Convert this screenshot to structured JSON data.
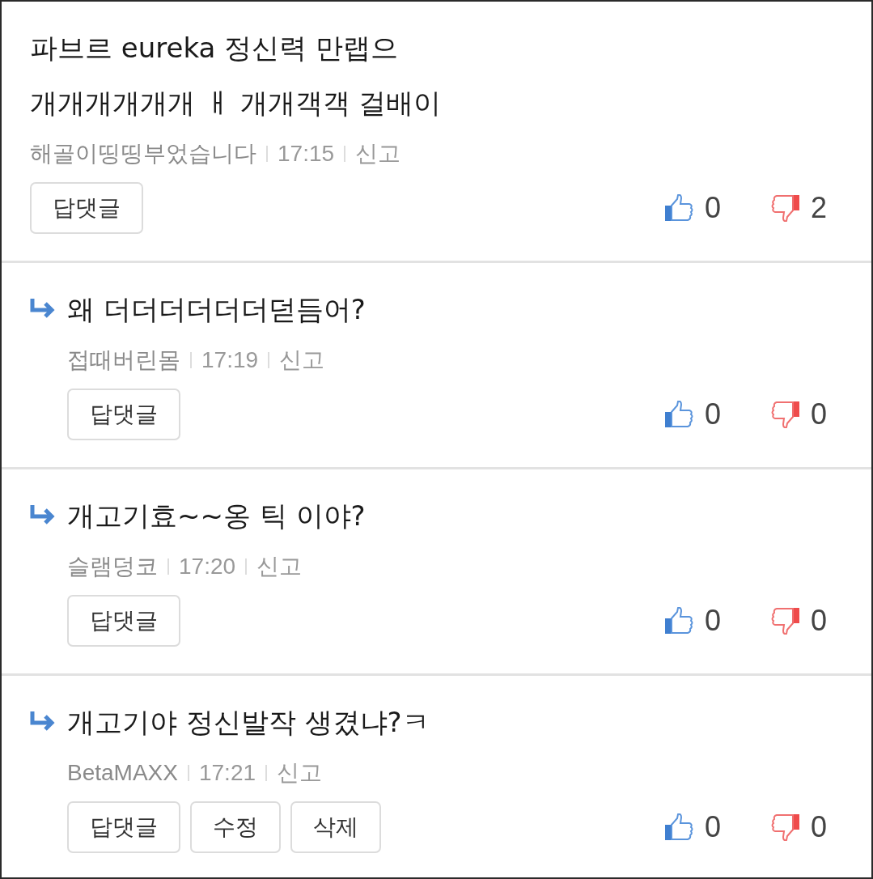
{
  "comments": [
    {
      "reply": false,
      "text": "파브르 eureka 정신력 만랩으\n개개개개개개 ㅐ 개개객객 걸배이",
      "author": "해골이띵띵부었습니다",
      "time": "17:15",
      "report": "신고",
      "buttons": [
        "답댓글"
      ],
      "likes": "0",
      "dislikes": "2"
    },
    {
      "reply": true,
      "text": "왜 더더더더더더덛듬어?",
      "author": "접때버린몸",
      "time": "17:19",
      "report": "신고",
      "buttons": [
        "답댓글"
      ],
      "likes": "0",
      "dislikes": "0"
    },
    {
      "reply": true,
      "text": "개고기효~~옹 틱 이야?",
      "author": "슬램덩코",
      "time": "17:20",
      "report": "신고",
      "buttons": [
        "답댓글"
      ],
      "likes": "0",
      "dislikes": "0"
    },
    {
      "reply": true,
      "text": "개고기야 정신발작 생겼냐?ㅋ",
      "author": "BetaMAXX",
      "time": "17:21",
      "report": "신고",
      "buttons": [
        "답댓글",
        "수정",
        "삭제"
      ],
      "likes": "0",
      "dislikes": "0"
    }
  ]
}
